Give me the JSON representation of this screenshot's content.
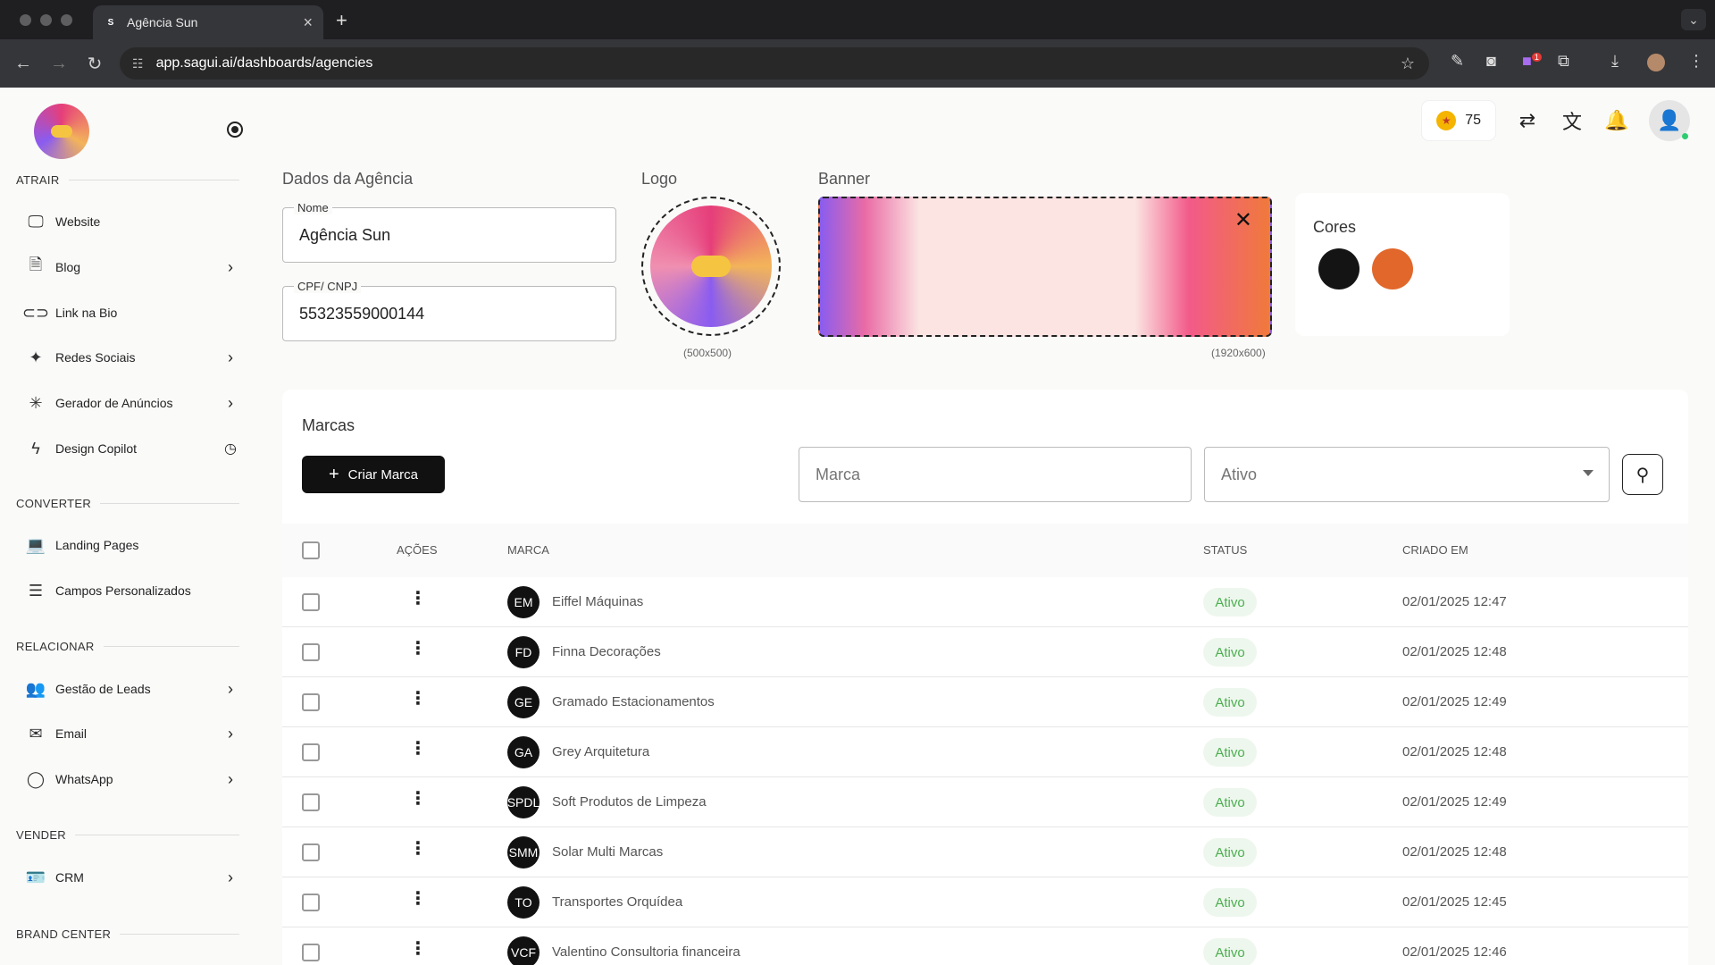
{
  "browser": {
    "tab_title": "Agência Sun",
    "tab_favicon": "S",
    "url": "app.sagui.ai/dashboards/agencies",
    "ext_badge": "1"
  },
  "sidebar": {
    "sections": [
      {
        "label": "ATRAIR",
        "items": [
          {
            "label": "Website",
            "icon": "monitor-icon",
            "chevron": false
          },
          {
            "label": "Blog",
            "icon": "document-icon",
            "chevron": true
          },
          {
            "label": "Link na Bio",
            "icon": "link-icon",
            "chevron": false
          },
          {
            "label": "Redes Sociais",
            "icon": "sparkles-icon",
            "chevron": true
          },
          {
            "label": "Gerador de Anúncios",
            "icon": "loader-icon",
            "chevron": true
          },
          {
            "label": "Design Copilot",
            "icon": "bolt-icon",
            "chevron": false
          }
        ]
      },
      {
        "label": "CONVERTER",
        "items": [
          {
            "label": "Landing Pages",
            "icon": "laptop-icon",
            "chevron": false
          },
          {
            "label": "Campos Personalizados",
            "icon": "list-icon",
            "chevron": false
          }
        ]
      },
      {
        "label": "RELACIONAR",
        "items": [
          {
            "label": "Gestão de Leads",
            "icon": "users-icon",
            "chevron": true
          },
          {
            "label": "Email",
            "icon": "mail-icon",
            "chevron": true
          },
          {
            "label": "WhatsApp",
            "icon": "whatsapp-icon",
            "chevron": true
          }
        ]
      },
      {
        "label": "VENDER",
        "items": [
          {
            "label": "CRM",
            "icon": "id-card-icon",
            "chevron": true
          }
        ]
      },
      {
        "label": "BRAND CENTER",
        "items": []
      }
    ]
  },
  "topbar": {
    "coins": "75"
  },
  "agency": {
    "section_title": "Dados da Agência",
    "name_label": "Nome",
    "name_value": "Agência Sun",
    "cnpj_label": "CPF/ CNPJ",
    "cnpj_value": "55323559000144",
    "logo_title": "Logo",
    "logo_size": "(500x500)",
    "banner_title": "Banner",
    "banner_size": "(1920x600)",
    "colors_title": "Cores",
    "colors": [
      "#141414",
      "#e2672b"
    ]
  },
  "brands": {
    "title": "Marcas",
    "create_label": "Criar Marca",
    "filter_placeholder": "Marca",
    "status_placeholder": "Ativo",
    "columns": {
      "actions": "AÇÕES",
      "brand": "MARCA",
      "status": "STATUS",
      "created": "CRIADO EM"
    },
    "rows": [
      {
        "initials": "EM",
        "name": "Eiffel Máquinas",
        "status": "Ativo",
        "created": "02/01/2025 12:47"
      },
      {
        "initials": "FD",
        "name": "Finna Decorações",
        "status": "Ativo",
        "created": "02/01/2025 12:48"
      },
      {
        "initials": "GE",
        "name": "Gramado Estacionamentos",
        "status": "Ativo",
        "created": "02/01/2025 12:49"
      },
      {
        "initials": "GA",
        "name": "Grey Arquitetura",
        "status": "Ativo",
        "created": "02/01/2025 12:48"
      },
      {
        "initials": "SPDL",
        "name": "Soft Produtos de Limpeza",
        "status": "Ativo",
        "created": "02/01/2025 12:49"
      },
      {
        "initials": "SMM",
        "name": "Solar Multi Marcas",
        "status": "Ativo",
        "created": "02/01/2025 12:48"
      },
      {
        "initials": "TO",
        "name": "Transportes Orquídea",
        "status": "Ativo",
        "created": "02/01/2025 12:45"
      },
      {
        "initials": "VCF",
        "name": "Valentino Consultoria financeira",
        "status": "Ativo",
        "created": "02/01/2025 12:46"
      }
    ]
  }
}
